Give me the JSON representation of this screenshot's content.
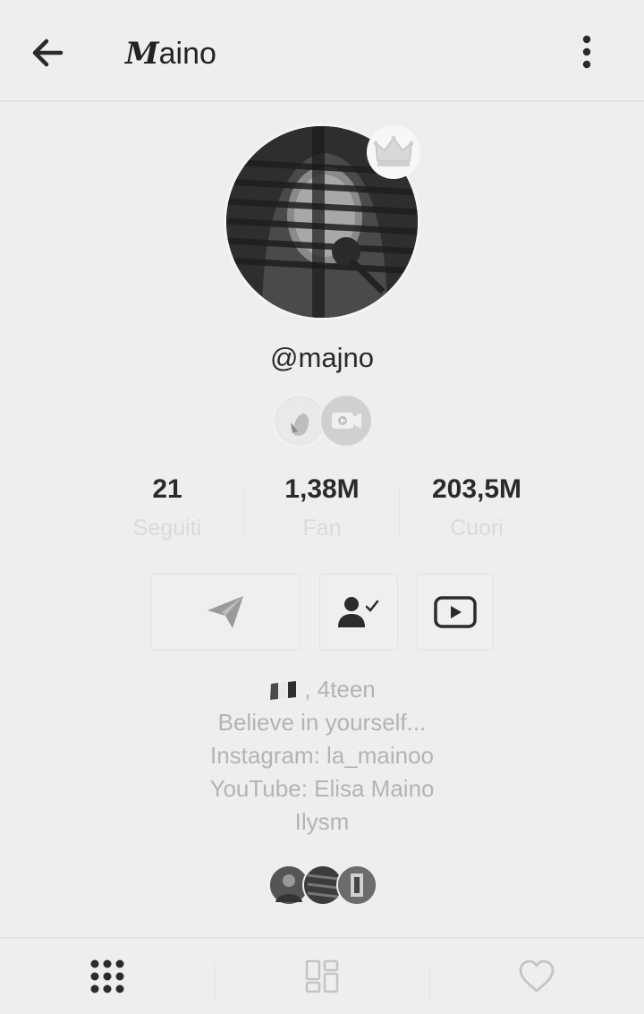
{
  "header": {
    "title_initial": "M",
    "title_rest": "aino",
    "back_icon": "arrow-left-icon",
    "menu_icon": "vertical-dots-icon"
  },
  "profile": {
    "username": "@majno",
    "crown_icon": "crown-icon",
    "badges": [
      "creator-badge",
      "video-badge"
    ]
  },
  "stats": [
    {
      "value": "21",
      "label": "Seguiti"
    },
    {
      "value": "1,38M",
      "label": "Fan"
    },
    {
      "value": "203,5M",
      "label": "Cuori"
    }
  ],
  "actions": [
    {
      "icon": "send-icon"
    },
    {
      "icon": "user-check-icon"
    },
    {
      "icon": "youtube-icon"
    }
  ],
  "bio": {
    "line1_suffix": ", 4teen",
    "line2": "Believe in yourself...",
    "line3": "Instagram: la_mainoo",
    "line4": "YouTube: Elisa Maino",
    "line5": "Ilysm"
  },
  "tabs": [
    {
      "icon": "grid-icon",
      "active": true
    },
    {
      "icon": "collections-icon",
      "active": false
    },
    {
      "icon": "heart-icon",
      "active": false
    }
  ],
  "colors": {
    "background": "#eeeeee",
    "text_dark": "#2a2a2a",
    "text_muted": "#b4b4b4",
    "label_faint": "#dadada"
  }
}
